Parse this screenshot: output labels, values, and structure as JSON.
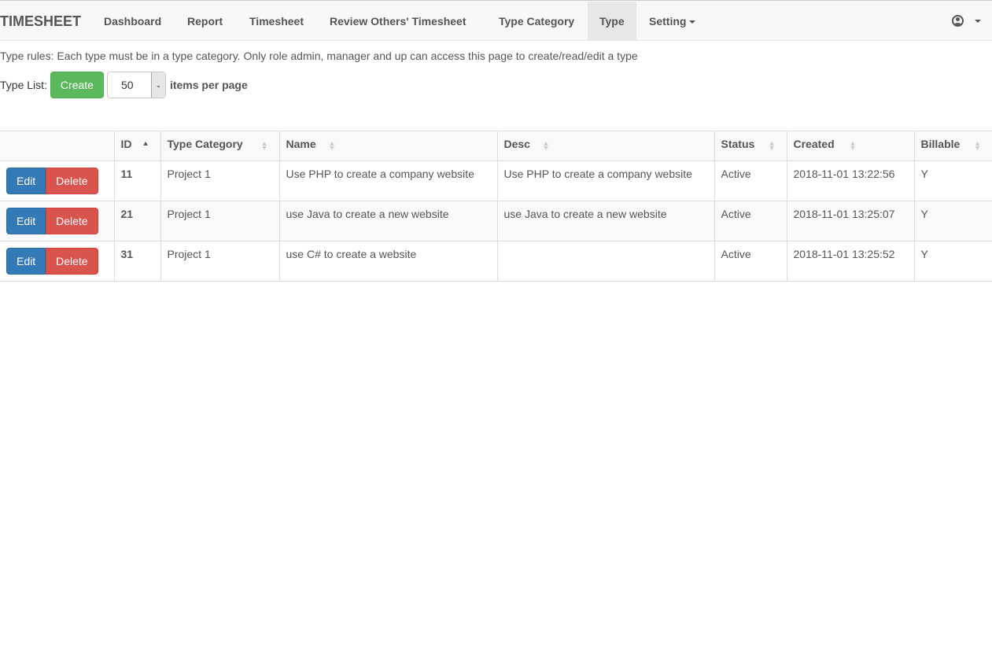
{
  "nav": {
    "brand": "TIMESHEET",
    "items": [
      "Dashboard",
      "Report",
      "Timesheet",
      "Review Others' Timesheet",
      "Type Category",
      "Type",
      "Setting"
    ],
    "active": "Type"
  },
  "rules": "Type rules: Each type must be in a type category. Only role admin, manager and up can access this page to create/read/edit a type",
  "toolbar": {
    "label": "Type List:",
    "create": "Create",
    "per_page": "50",
    "per_page_label": "items per page"
  },
  "table": {
    "headers": [
      "ID",
      "Type Category",
      "Name",
      "Desc",
      "Status",
      "Created",
      "Billable"
    ],
    "edit": "Edit",
    "delete": "Delete",
    "rows": [
      [
        "11",
        "Project 1",
        "Use PHP to create a company website",
        "Use PHP to create a company website",
        "Active",
        "2018-11-01 13:22:56",
        "Y"
      ],
      [
        "21",
        "Project 1",
        "use Java to create a new website",
        "use Java to create a new website",
        "Active",
        "2018-11-01 13:25:07",
        "Y"
      ],
      [
        "31",
        "Project 1",
        "use C# to create a website",
        "",
        "Active",
        "2018-11-01 13:25:52",
        "Y"
      ]
    ]
  }
}
